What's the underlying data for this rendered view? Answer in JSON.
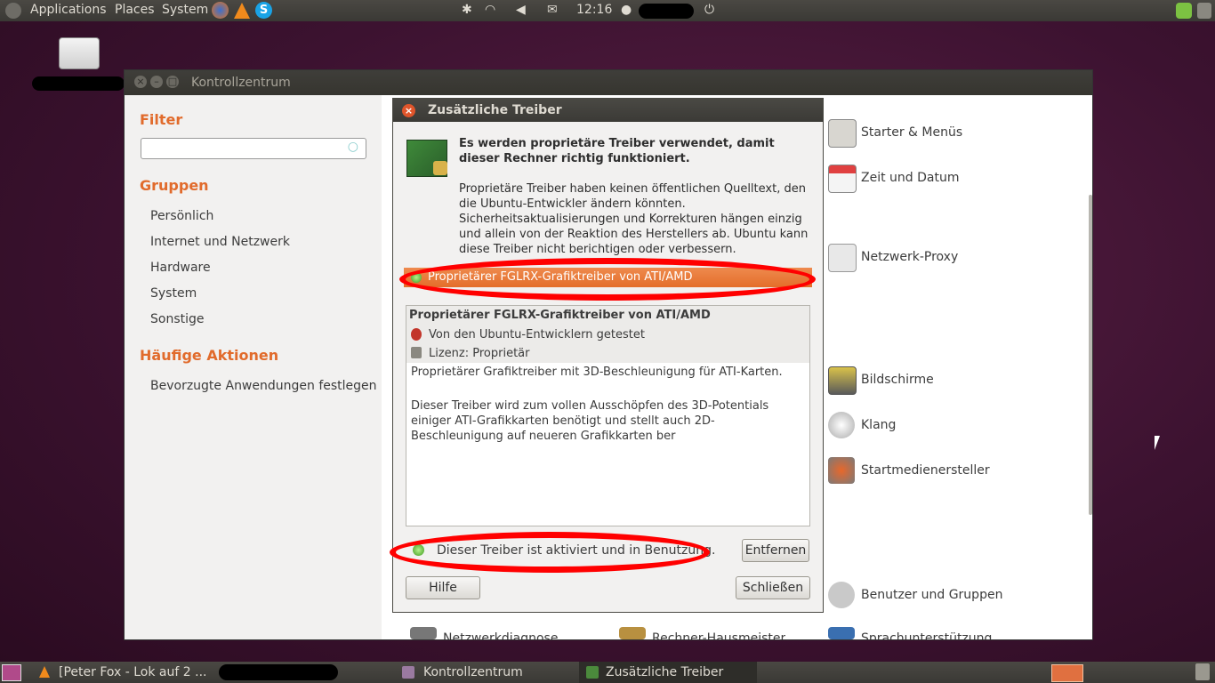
{
  "top_panel": {
    "menus": [
      "Applications",
      "Places",
      "System"
    ],
    "clock": "12:16"
  },
  "window": {
    "title": "Kontrollzentrum",
    "sidebar": {
      "filter_heading": "Filter",
      "groups_heading": "Gruppen",
      "groups": [
        "Persönlich",
        "Internet und Netzwerk",
        "Hardware",
        "System",
        "Sonstige"
      ],
      "actions_heading": "Häufige Aktionen",
      "actions": [
        "Bevorzugte Anwendungen festlegen"
      ]
    },
    "items": [
      "Starter & Menüs",
      "Zeit und Datum",
      "Netzwerk-Proxy",
      "Bildschirme",
      "Klang",
      "Startmedienersteller",
      "Benutzer und Gruppen"
    ],
    "bottom_items": [
      "Netzwerkdiagnose",
      "Rechner-Hausmeister",
      "Sprachunterstützung"
    ]
  },
  "dialog": {
    "title": "Zusätzliche Treiber",
    "headline": "Es werden proprietäre Treiber verwendet, damit dieser Rechner richtig funktioniert.",
    "body": "Proprietäre Treiber haben keinen öffentlichen Quelltext, den die Ubuntu-Entwickler ändern könnten. Sicherheitsaktualisierungen und Korrekturen hängen einzig und allein von der Reaktion des Herstellers ab. Ubuntu kann diese Treiber nicht berichtigen oder verbessern.",
    "driver_name": "Proprietärer FGLRX-Grafiktreiber von ATI/AMD",
    "details_title": "Proprietärer FGLRX-Grafiktreiber von ATI/AMD",
    "tested": "Von den Ubuntu-Entwicklern getestet",
    "license": "Lizenz: Proprietär",
    "description1": "Proprietärer Grafiktreiber mit 3D-Beschleunigung für ATI-Karten.",
    "description2": "Dieser Treiber wird zum vollen Ausschöpfen des 3D-Potentials einiger ATI-Grafikkarten benötigt und stellt auch 2D-Beschleunigung auf neueren Grafikkarten ber",
    "status": "Dieser Treiber ist aktiviert und in Benutzung.",
    "remove_button": "Entfernen",
    "help_button": "Hilfe",
    "close_button": "Schließen"
  },
  "bottom_panel": {
    "tasks": [
      "[Peter Fox - Lok auf 2 ...",
      "Kontrollzentrum",
      "Zusätzliche Treiber"
    ]
  },
  "colors": {
    "accent": "#e16b2c",
    "highlight": "#ff0000"
  }
}
